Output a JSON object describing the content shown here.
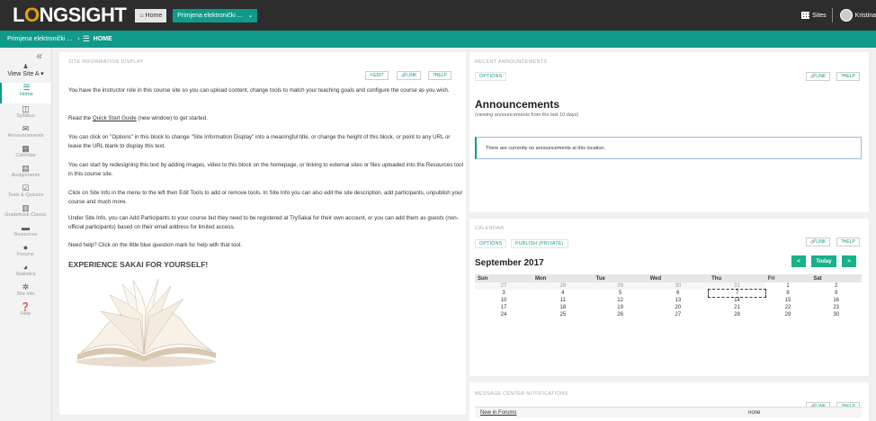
{
  "topbar": {
    "logo_prefix": "L",
    "logo_o": "O",
    "logo_suffix": "NGSIGHT",
    "home_label": "Home",
    "site_label": "Primjena elektronički ...",
    "sites_label": "Sites",
    "user_name": "Kristina"
  },
  "breadcrumb": {
    "site": "Primjena elektronički ...",
    "separator": "›",
    "page": "HOME"
  },
  "sidebar": {
    "collapse": "«",
    "view_site": "View Site A",
    "items": [
      {
        "label": "Home",
        "icon": "home-icon",
        "glyph": "☰"
      },
      {
        "label": "Syllabus",
        "icon": "book-icon",
        "glyph": "◫"
      },
      {
        "label": "Announcements",
        "icon": "megaphone-icon",
        "glyph": "✉"
      },
      {
        "label": "Calendar",
        "icon": "calendar-icon",
        "glyph": "▦"
      },
      {
        "label": "Assignments",
        "icon": "assignment-icon",
        "glyph": "▤"
      },
      {
        "label": "Tests & Quizzes",
        "icon": "check-icon",
        "glyph": "☑"
      },
      {
        "label": "Gradebook Classic",
        "icon": "gradebook-icon",
        "glyph": "▥"
      },
      {
        "label": "Resources",
        "icon": "folder-icon",
        "glyph": "▬"
      },
      {
        "label": "Forums",
        "icon": "forums-icon",
        "glyph": "●"
      },
      {
        "label": "Statistics",
        "icon": "pie-icon",
        "glyph": "◕"
      },
      {
        "label": "Site Info",
        "icon": "gear-icon",
        "glyph": "✲"
      },
      {
        "label": "Help",
        "icon": "help-icon",
        "glyph": "❓"
      }
    ]
  },
  "site_info": {
    "title": "SITE INFORMATION DISPLAY",
    "edit": "✎EDIT",
    "link": "LINK",
    "help": "?HELP",
    "p1": "You have the instructor role in this course site so you can upload content, change tools to match your teaching goals and configure the course as you wish.",
    "p2_pre": "Read the ",
    "p2_link": "Quick Start Guide",
    "p2_post": " (new window) to get started.",
    "p3": "You can click on \"Options\" in this block to change \"Site Information Display\" into a meaningful title, or change the height of this block, or point to any URL or leave the URL blank to display this text.",
    "p4": "You can start by redesigning this text by adding images, video to this block on the homepage, or linking to external sites or files uploaded into the Resources tool in this course site.",
    "p5": "Click on Site Info in the menu to the left then Edit Tools to add or remove tools.  In Site Info you can also edit the site description, add participants, unpublish your course and much more.",
    "p6": "Under Site Info, you can Add Participants to your course but they need to be registered at TrySakai for their own account, or you can add them as guests (non-official participants) based on their email address for limited access.",
    "p7": "Need help?  Click on the little blue question mark for help with that tool.",
    "heading": "EXPERIENCE SAKAI FOR YOURSELF!"
  },
  "announcements": {
    "title": "RECENT ANNOUNCEMENTS",
    "options": "OPTIONS",
    "link": "LINK",
    "help": "?HELP",
    "heading": "Announcements",
    "subheading": "(viewing announcements from the last 10 days)",
    "empty": "There are currently no announcements at this location."
  },
  "calendar": {
    "title": "CALENDAR",
    "options": "OPTIONS",
    "publish": "PUBLISH (PRIVATE)",
    "link": "LINK",
    "help": "?HELP",
    "month": "September 2017",
    "prev": "<",
    "today": "Today",
    "next": ">",
    "days": [
      "Sun",
      "Mon",
      "Tue",
      "Wed",
      "Thu",
      "Fri",
      "Sat"
    ],
    "weeks": [
      [
        "27",
        "28",
        "29",
        "30",
        "31",
        "1",
        "2"
      ],
      [
        "3",
        "4",
        "5",
        "6",
        "7",
        "8",
        "9"
      ],
      [
        "10",
        "11",
        "12",
        "13",
        "14",
        "15",
        "16"
      ],
      [
        "17",
        "18",
        "19",
        "20",
        "21",
        "22",
        "23"
      ],
      [
        "24",
        "25",
        "26",
        "27",
        "28",
        "29",
        "30"
      ]
    ],
    "other_month_count": 5,
    "today_date": "7"
  },
  "messages": {
    "title": "MESSAGE CENTER NOTIFICATIONS",
    "link": "LINK",
    "help": "?HELP",
    "row_label": "New in Forums",
    "row_value": "none"
  },
  "colors": {
    "accent": "#0f9a8a",
    "topbar": "#2d2d2d",
    "logo_o": "#e8a000"
  }
}
